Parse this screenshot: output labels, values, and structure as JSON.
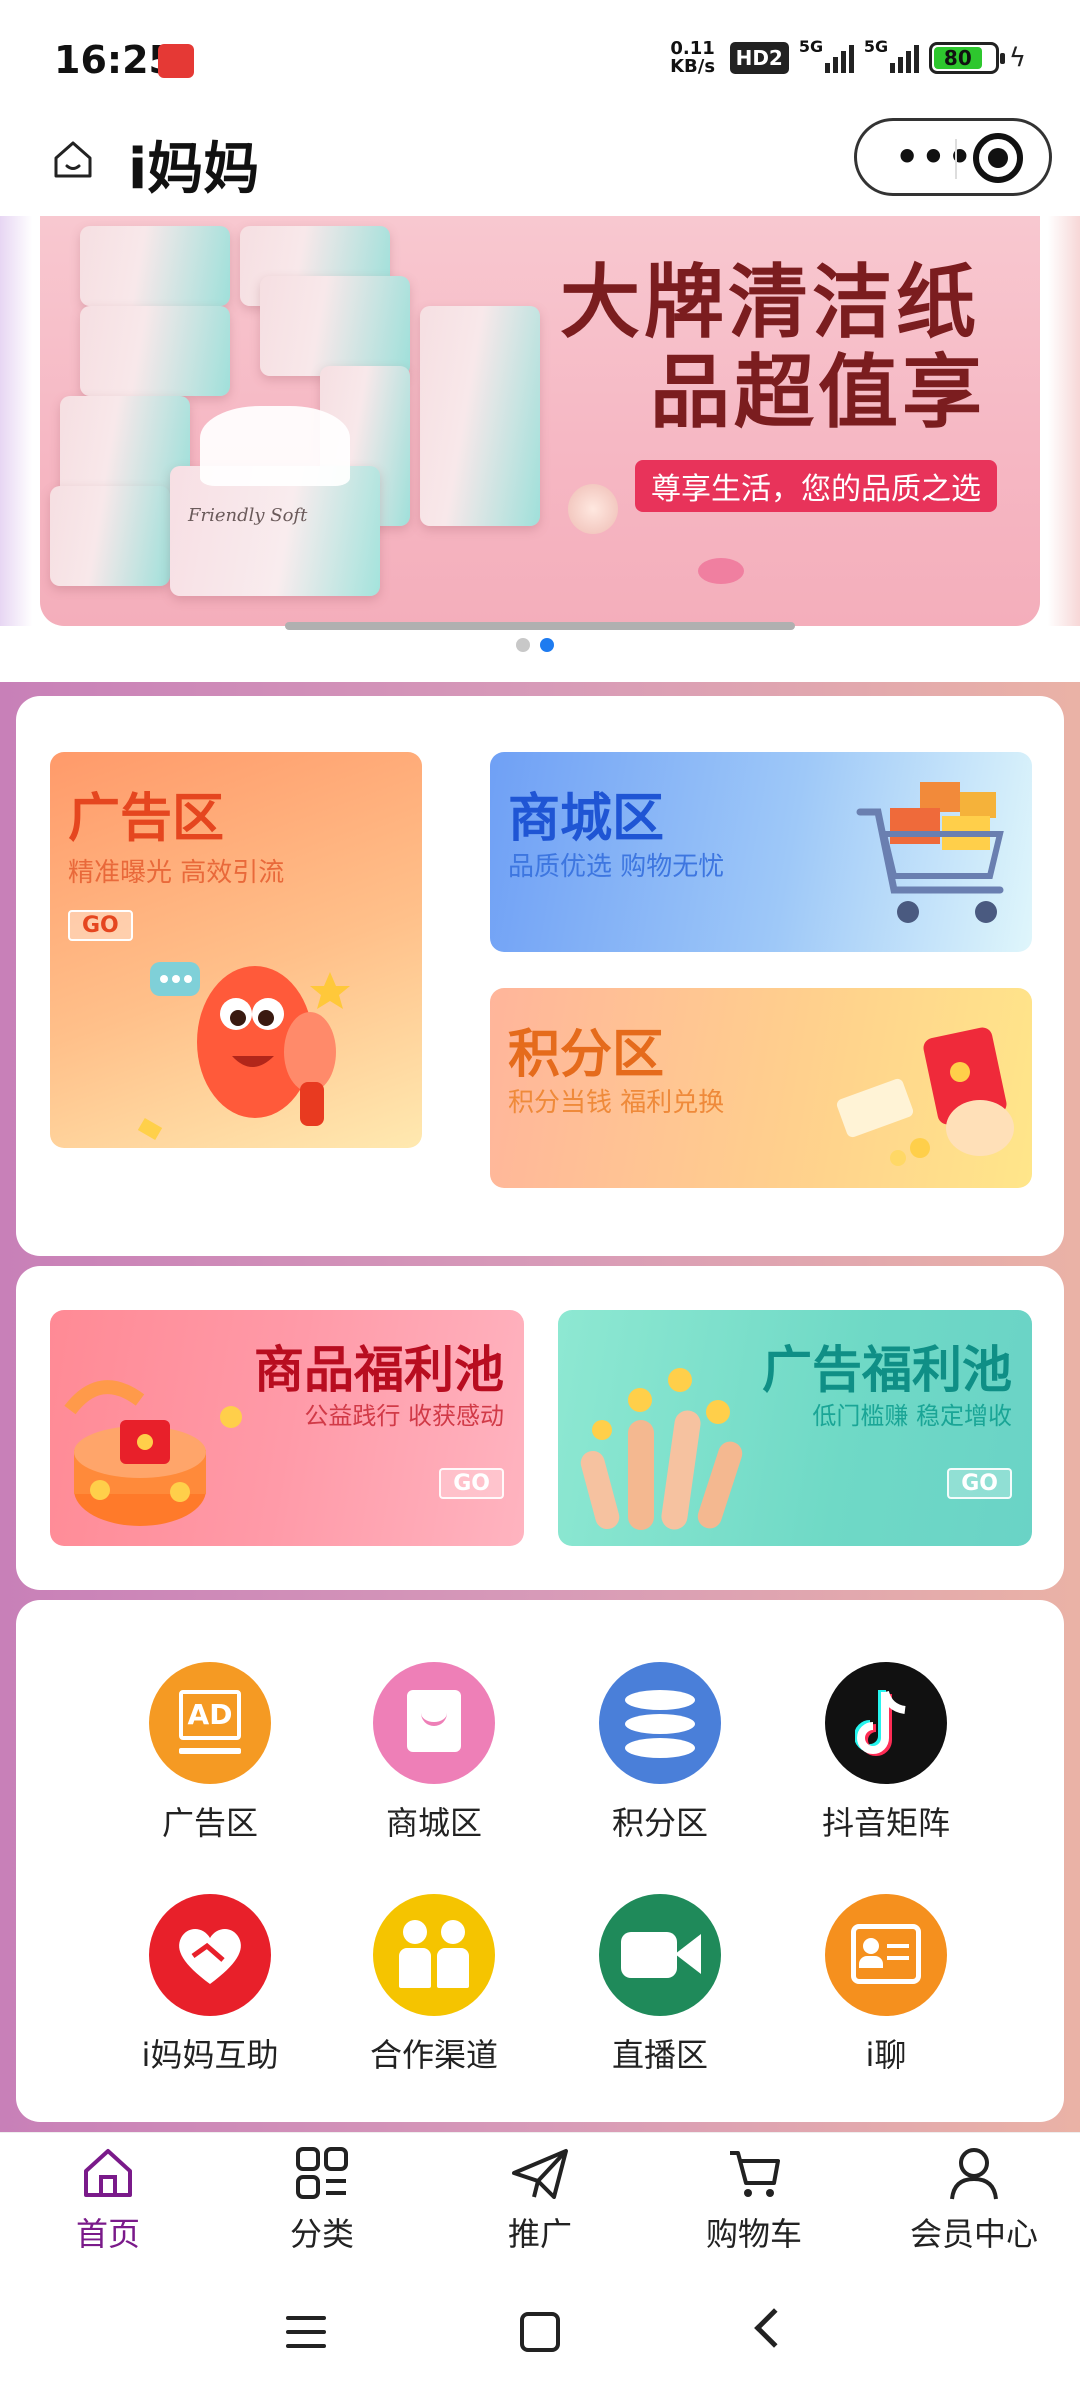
{
  "status": {
    "time": "16:25",
    "net_speed_top": "0.11",
    "net_speed_bottom": "KB/s",
    "hd": "HD2",
    "sim1": "5G",
    "sim2": "5G",
    "battery": "80"
  },
  "title_bar": {
    "title": "i妈妈"
  },
  "banner": {
    "headline1": "大牌清洁纸",
    "headline2": "品超值享",
    "tagline": "尊享生活，您的品质之选",
    "product_script": "Friendly Soft",
    "carousel_index": 2,
    "carousel_total": 2
  },
  "zones": {
    "ad": {
      "title": "广告区",
      "subtitle": "精准曝光 高效引流",
      "go": "GO"
    },
    "mall": {
      "title": "商城区",
      "subtitle": "品质优选 购物无忧"
    },
    "points": {
      "title": "积分区",
      "subtitle": "积分当钱 福利兑换"
    }
  },
  "pools": {
    "goods": {
      "title": "商品福利池",
      "subtitle": "公益践行 收获感动",
      "go": "GO"
    },
    "ads": {
      "title": "广告福利池",
      "subtitle": "低门槛赚 稳定增收",
      "go": "GO"
    }
  },
  "grid": [
    {
      "label": "广告区",
      "icon": "ad-icon",
      "color": "#f59a23",
      "badge": "AD"
    },
    {
      "label": "商城区",
      "icon": "shopping-bag-icon",
      "color": "#ee7fb7"
    },
    {
      "label": "积分区",
      "icon": "coins-stack-icon",
      "color": "#4a7fd9"
    },
    {
      "label": "抖音矩阵",
      "icon": "douyin-icon",
      "color": "#111111"
    },
    {
      "label": "i妈妈互助",
      "icon": "heart-handshake-icon",
      "color": "#e8202a"
    },
    {
      "label": "合作渠道",
      "icon": "partners-icon",
      "color": "#f5c400"
    },
    {
      "label": "直播区",
      "icon": "video-camera-icon",
      "color": "#1f8a5a"
    },
    {
      "label": "i聊",
      "icon": "contact-card-icon",
      "color": "#f5901e"
    }
  ],
  "tabbar": [
    {
      "label": "首页",
      "icon": "home-icon",
      "active": true
    },
    {
      "label": "分类",
      "icon": "category-grid-icon",
      "active": false
    },
    {
      "label": "推广",
      "icon": "paper-plane-icon",
      "active": false
    },
    {
      "label": "购物车",
      "icon": "cart-icon",
      "active": false
    },
    {
      "label": "会员中心",
      "icon": "user-icon",
      "active": false
    }
  ],
  "colors": {
    "accent_purple": "#7a1a8a",
    "carousel_active": "#1e7bf0"
  }
}
